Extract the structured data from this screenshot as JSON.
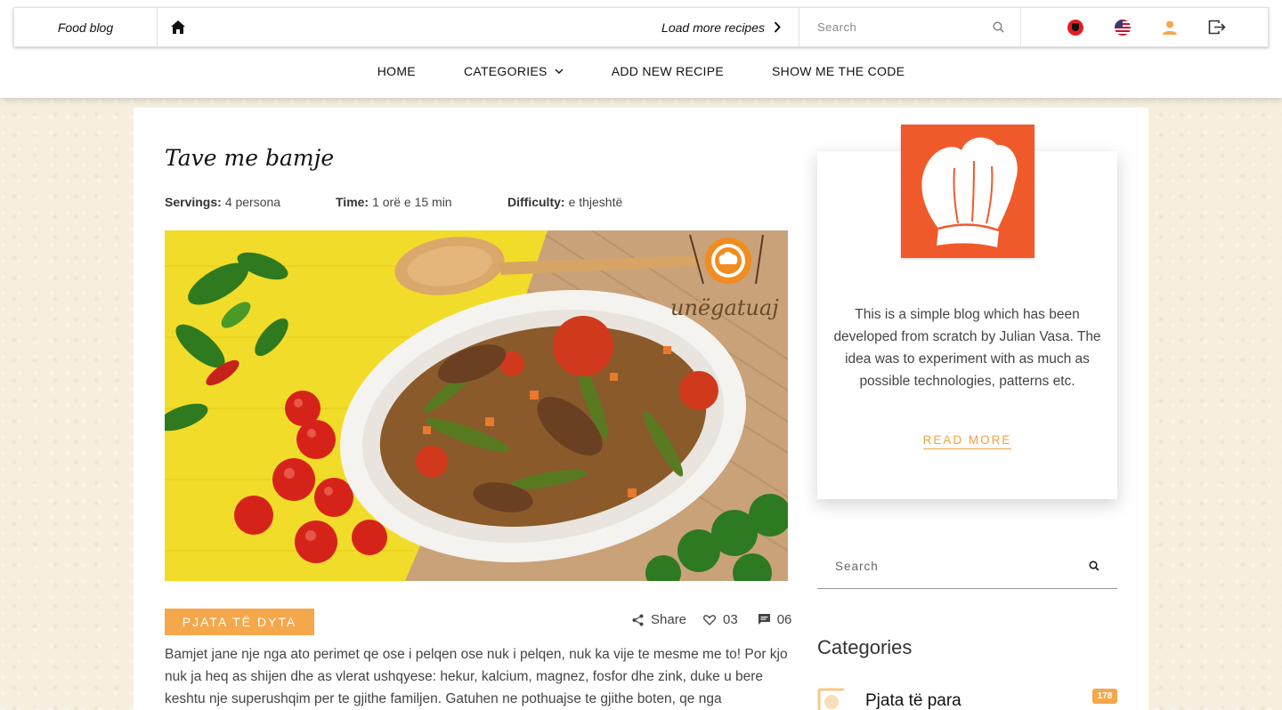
{
  "header": {
    "brand": "Food blog",
    "load_more": "Load more recipes",
    "search_placeholder": "Search",
    "icons": [
      "home-icon",
      "chevron-right-icon",
      "search-icon",
      "albanian-flag-icon",
      "us-flag-icon",
      "user-icon",
      "logout-icon"
    ]
  },
  "nav": {
    "items": [
      "HOME",
      "CATEGORIES",
      "ADD NEW RECIPE",
      "SHOW ME THE CODE"
    ]
  },
  "post": {
    "title": "Tave me bamje",
    "servings_label": "Servings:",
    "servings_value": "4 persona",
    "time_label": "Time:",
    "time_value": "1 orë e 15 min",
    "difficulty_label": "Difficulty:",
    "difficulty_value": "e thjeshtë",
    "image_watermark": "unëgatuaj",
    "category": "PJATA TË DYTA",
    "share_label": "Share",
    "likes": "03",
    "comments": "06",
    "excerpt": "Bamjet jane nje nga ato perimet qe ose i pelqen ose nuk i pelqen, nuk ka vije te mesme me to! Por kjo nuk ja heq as shijen dhe as vlerat ushqyese: hekur, kalcium, magnez, fosfor dhe zink, duke u bere keshtu nje superushqim per te gjithe familjen. Gatuhen ne pothuajse te gjithe boten, qe nga"
  },
  "sidebar": {
    "about_text": "This is a simple blog which has been developed from scratch by Julian Vasa. The idea was to experiment with as much as possible technologies, patterns etc.",
    "read_more": "READ MORE",
    "search_placeholder": "Search",
    "categories_heading": "Categories",
    "categories": [
      {
        "name": "Pjata të para",
        "count": "178"
      }
    ]
  },
  "colors": {
    "accent": "#f4a84b",
    "logo_bg": "#f05a2b",
    "page_bg": "#f6efe0"
  }
}
